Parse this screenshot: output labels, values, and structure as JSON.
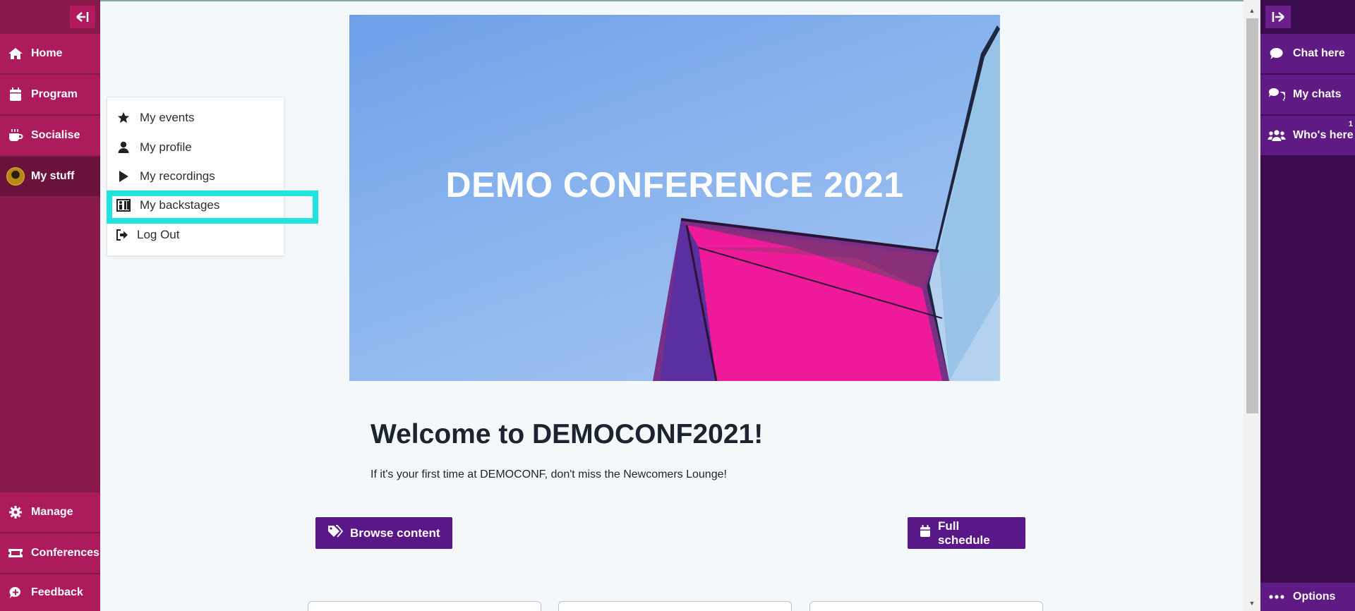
{
  "left_nav": {
    "items": [
      {
        "label": "Home",
        "icon": "home-icon"
      },
      {
        "label": "Program",
        "icon": "calendar-icon"
      },
      {
        "label": "Socialise",
        "icon": "coffee-icon"
      },
      {
        "label": "My stuff",
        "icon": "avatar"
      }
    ],
    "bottom_items": [
      {
        "label": "Manage",
        "icon": "gear-icon"
      },
      {
        "label": "Conferences",
        "icon": "ticket-icon"
      },
      {
        "label": "Feedback",
        "icon": "feedback-icon"
      }
    ]
  },
  "right_nav": {
    "items": [
      {
        "label": "Chat here",
        "icon": "chat-icon"
      },
      {
        "label": "My chats",
        "icon": "chats-icon"
      },
      {
        "label": "Who's here",
        "icon": "users-icon",
        "badge": "1"
      }
    ],
    "options_label": "Options"
  },
  "dropdown": {
    "items": [
      {
        "label": "My events",
        "icon": "star-icon"
      },
      {
        "label": "My profile",
        "icon": "user-icon"
      },
      {
        "label": "My recordings",
        "icon": "play-icon"
      },
      {
        "label": "My backstages",
        "icon": "backstage-icon"
      },
      {
        "label": "Log Out",
        "icon": "logout-icon"
      }
    ]
  },
  "main": {
    "banner_title": "DEMO CONFERENCE 2021",
    "welcome_title": "Welcome to DEMOCONF2021!",
    "welcome_sub": "If it's your first time at DEMOCONF, don't miss the Newcomers Lounge!",
    "browse_label": "Browse content",
    "schedule_label": "Full schedule"
  },
  "colors": {
    "left_sidebar": "#871a4a",
    "left_item": "#ac1c5c",
    "right_sidebar": "#3b0c4f",
    "right_item": "#5f1a84",
    "primary_button": "#5a1787",
    "highlight": "#21e3e0"
  }
}
